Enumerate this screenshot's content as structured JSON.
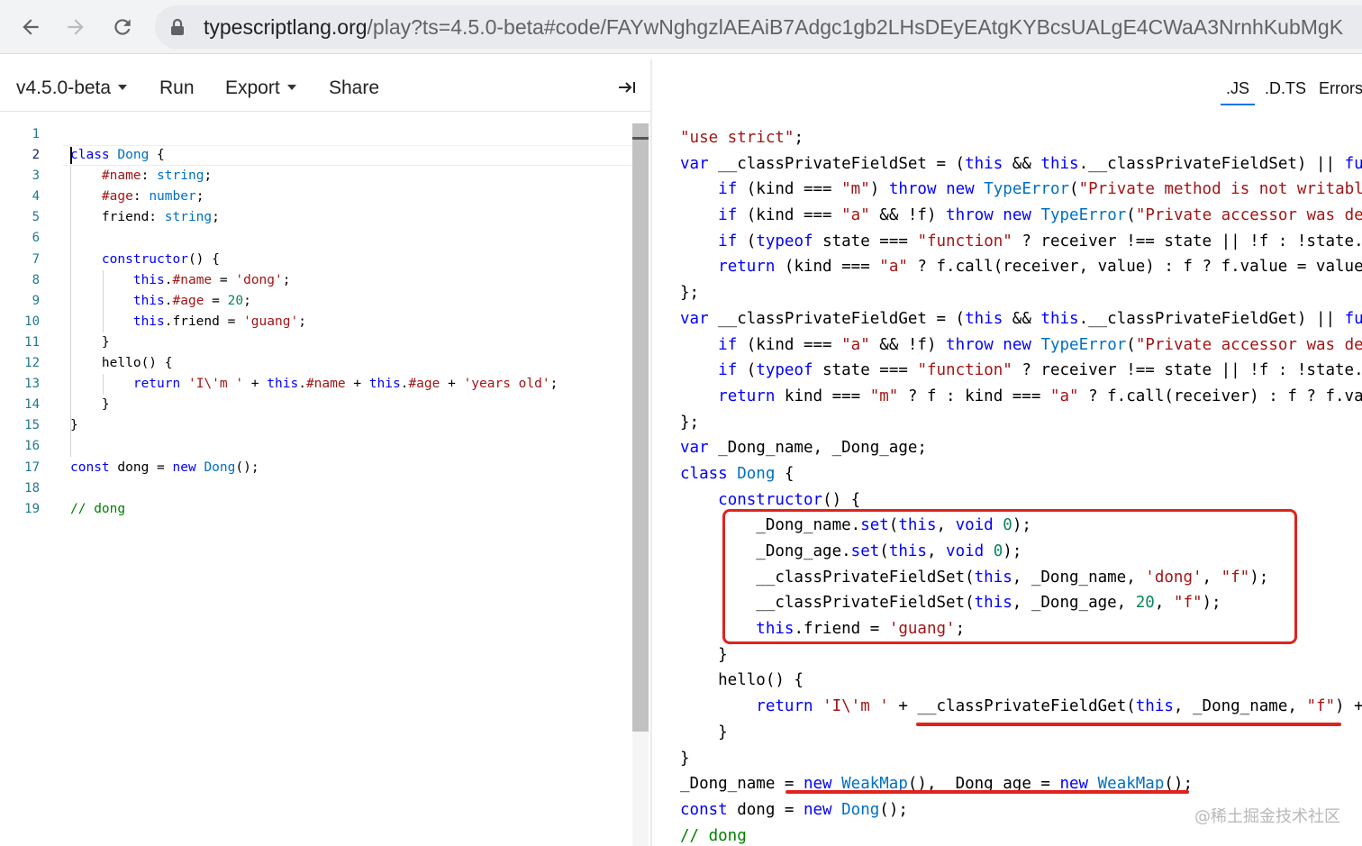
{
  "browser": {
    "url_host": "typescriptlang.org",
    "url_path": "/play?ts=4.5.0-beta#code/FAYwNghgzlAEAiB7Adgc1gb2LHsDEyEAtgKYBcsUALgE4CWaA3NrnhKubMgK"
  },
  "toolbar": {
    "version": "v4.5.0-beta",
    "run": "Run",
    "export": "Export",
    "share": "Share"
  },
  "output_tabs": {
    "js": ".JS",
    "dts": ".D.TS",
    "errors": "Errors"
  },
  "editor": {
    "line_numbers": [
      "1",
      "2",
      "3",
      "4",
      "5",
      "6",
      "7",
      "8",
      "9",
      "10",
      "11",
      "12",
      "13",
      "14",
      "15",
      "16",
      "17",
      "18",
      "19"
    ],
    "current_line": 2
  },
  "colors": {
    "keyword": "#0000ff",
    "type": "#0070c1",
    "string": "#a31515",
    "number": "#098658",
    "comment": "#008000",
    "annotation_red": "#e0231d"
  },
  "watermark": "@稀土掘金技术社区"
}
